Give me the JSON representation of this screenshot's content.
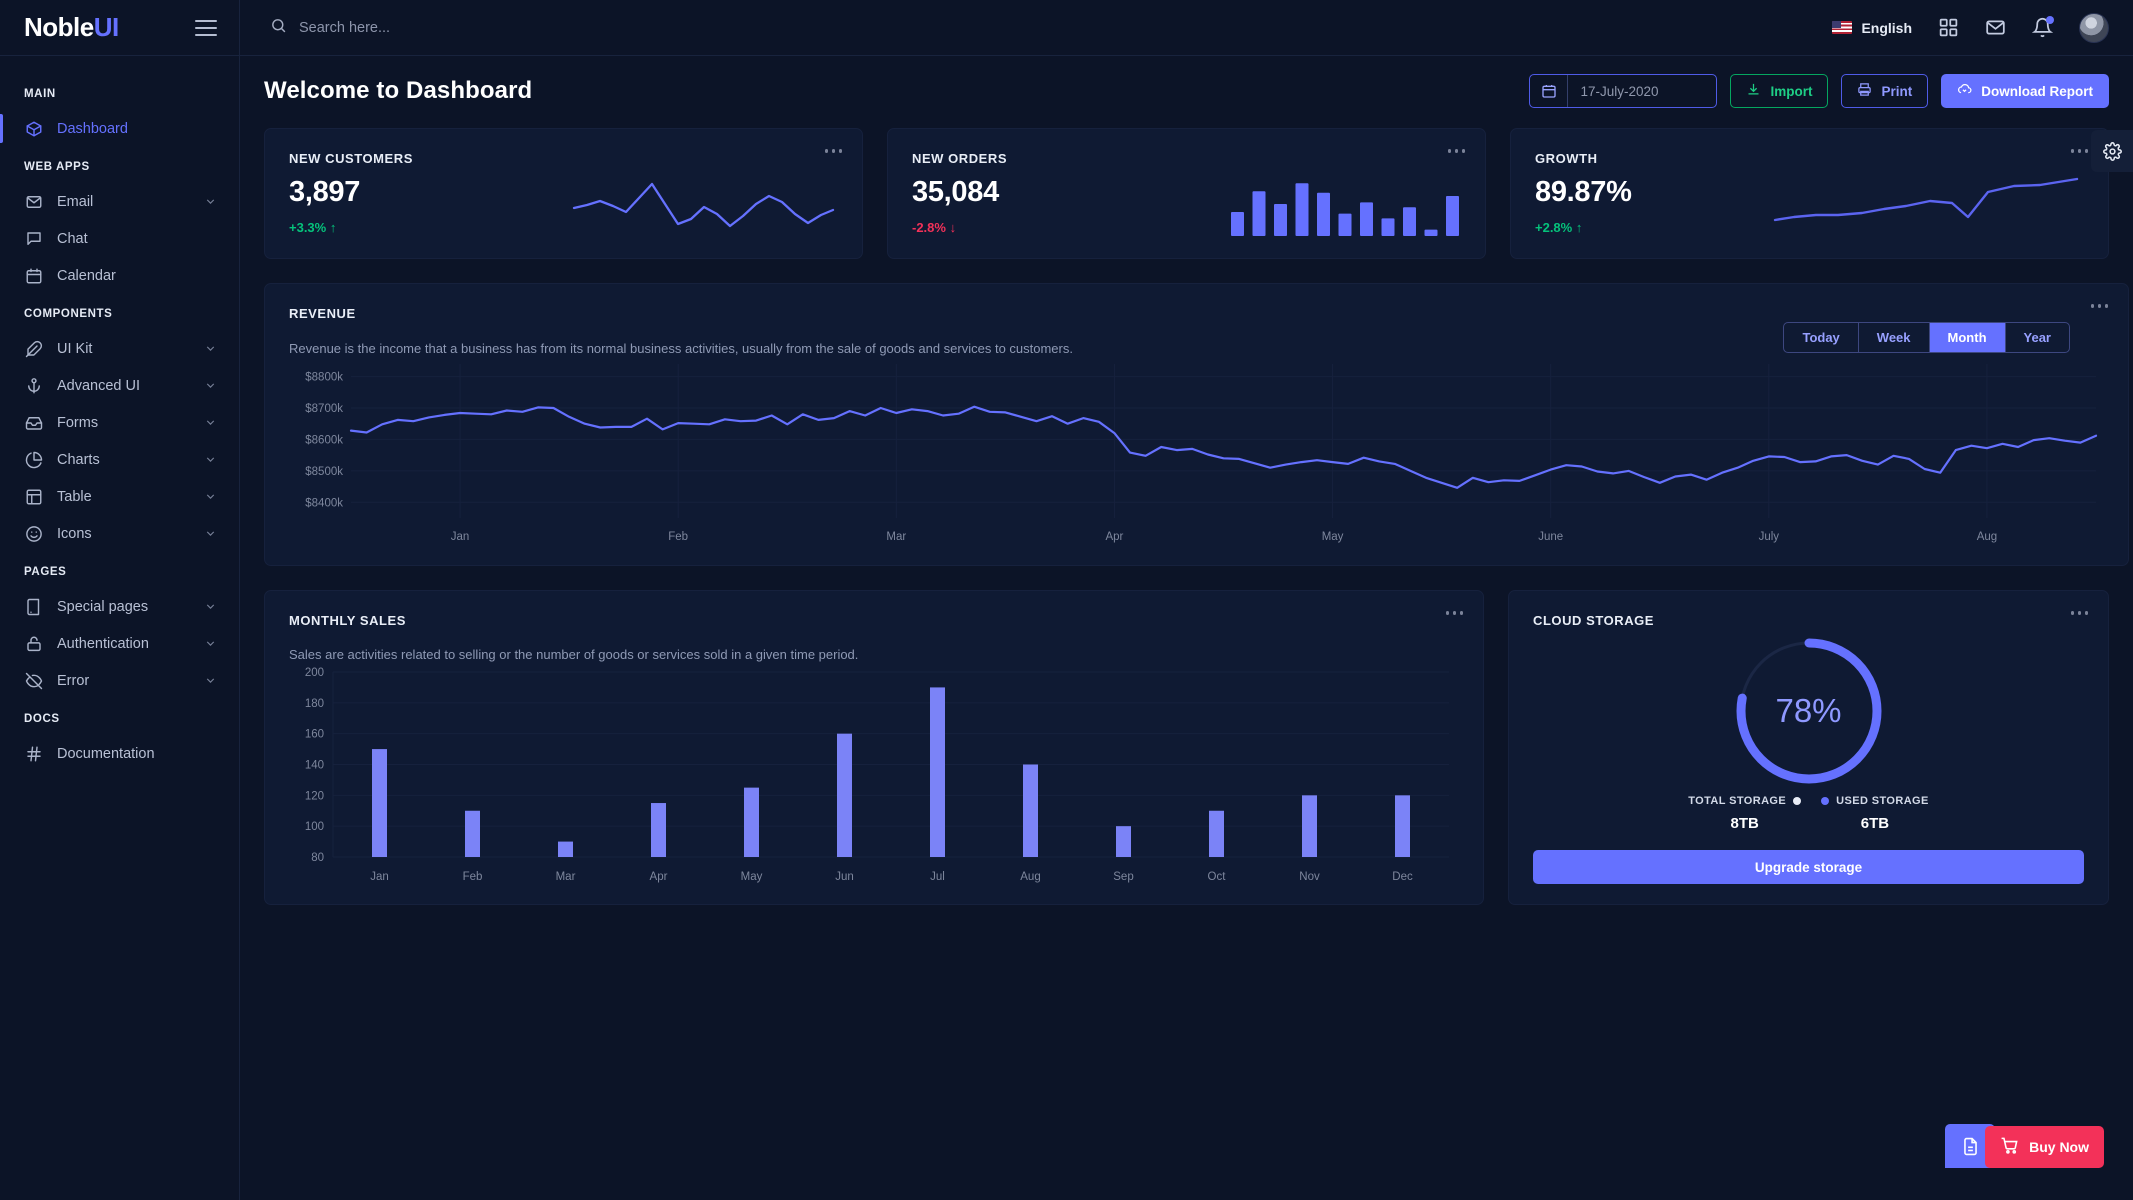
{
  "brand": {
    "part1": "Noble",
    "part2": "UI"
  },
  "topbar": {
    "search_placeholder": "Search here...",
    "language": "English",
    "icons": {
      "apps": "grid-apps-icon",
      "mail": "mail-icon",
      "bell": "bell-icon"
    }
  },
  "sidebar": {
    "sections": [
      {
        "label": "MAIN",
        "items": [
          {
            "label": "Dashboard",
            "icon": "box-icon",
            "active": true,
            "caret": false
          }
        ]
      },
      {
        "label": "WEB APPS",
        "items": [
          {
            "label": "Email",
            "icon": "mail-icon",
            "active": false,
            "caret": true
          },
          {
            "label": "Chat",
            "icon": "chat-icon",
            "active": false,
            "caret": false
          },
          {
            "label": "Calendar",
            "icon": "calendar-icon",
            "active": false,
            "caret": false
          }
        ]
      },
      {
        "label": "COMPONENTS",
        "items": [
          {
            "label": "UI Kit",
            "icon": "feather-icon",
            "active": false,
            "caret": true
          },
          {
            "label": "Advanced UI",
            "icon": "anchor-icon",
            "active": false,
            "caret": true
          },
          {
            "label": "Forms",
            "icon": "inbox-icon",
            "active": false,
            "caret": true
          },
          {
            "label": "Charts",
            "icon": "pie-chart-icon",
            "active": false,
            "caret": true
          },
          {
            "label": "Table",
            "icon": "table-layout-icon",
            "active": false,
            "caret": true
          },
          {
            "label": "Icons",
            "icon": "smile-icon",
            "active": false,
            "caret": true
          }
        ]
      },
      {
        "label": "PAGES",
        "items": [
          {
            "label": "Special pages",
            "icon": "book-icon",
            "active": false,
            "caret": true
          },
          {
            "label": "Authentication",
            "icon": "lock-icon",
            "active": false,
            "caret": true
          },
          {
            "label": "Error",
            "icon": "slash-eye-icon",
            "active": false,
            "caret": true
          }
        ]
      },
      {
        "label": "DOCS",
        "items": [
          {
            "label": "Documentation",
            "icon": "hash-icon",
            "active": false,
            "caret": false
          }
        ]
      }
    ]
  },
  "header": {
    "title": "Welcome to Dashboard",
    "date_value": "17-July-2020",
    "import_label": "Import",
    "print_label": "Print",
    "download_label": "Download Report"
  },
  "stats": [
    {
      "title": "NEW CUSTOMERS",
      "value": "3,897",
      "delta": "+3.3% ↑",
      "dir": "up"
    },
    {
      "title": "NEW ORDERS",
      "value": "35,084",
      "delta": "-2.8% ↓",
      "dir": "down"
    },
    {
      "title": "GROWTH",
      "value": "89.87%",
      "delta": "+2.8% ↑",
      "dir": "up"
    }
  ],
  "revenue": {
    "title": "REVENUE",
    "description": "Revenue is the income that a business has from its normal business activities, usually from the sale of goods and services to customers.",
    "ranges": [
      "Today",
      "Week",
      "Month",
      "Year"
    ],
    "active_range": "Month"
  },
  "monthly_sales": {
    "title": "MONTHLY SALES",
    "description": "Sales are activities related to selling or the number of goods or services sold in a given time period."
  },
  "cloud_storage": {
    "title": "CLOUD STORAGE",
    "percent": "78%",
    "total_label": "TOTAL STORAGE",
    "total_value": "8TB",
    "used_label": "USED STORAGE",
    "used_value": "6TB",
    "upgrade_label": "Upgrade storage"
  },
  "floating": {
    "buy_label": "Buy Now",
    "doc_icon": "document-icon",
    "gear_icon": "gear-icon"
  },
  "colors": {
    "accent": "#6571ff",
    "success": "#05c27b",
    "danger": "#f33159",
    "card_bg": "#0f1a33",
    "page_bg": "#0c1427",
    "grid": "#16213d"
  },
  "chart_data": [
    {
      "type": "line",
      "name": "new-customers-sparkline",
      "title": "NEW CUSTOMERS",
      "x": [
        0,
        1,
        2,
        3,
        4,
        5,
        6,
        7,
        8,
        9,
        10,
        11,
        12,
        13,
        14,
        15,
        16,
        17,
        18,
        19,
        20
      ],
      "values": [
        38,
        46,
        52,
        44,
        36,
        58,
        76,
        52,
        28,
        34,
        46,
        40,
        26,
        38,
        52,
        62,
        56,
        40,
        30,
        38,
        44
      ],
      "grid": false,
      "legend": "none"
    },
    {
      "type": "bar",
      "name": "new-orders-sparkbars",
      "title": "NEW ORDERS",
      "categories": [
        "1",
        "2",
        "3",
        "4",
        "5",
        "6",
        "7",
        "8",
        "9",
        "10",
        "11"
      ],
      "values": [
        30,
        56,
        40,
        66,
        54,
        28,
        42,
        22,
        36,
        8,
        50
      ],
      "grid": false,
      "legend": "none"
    },
    {
      "type": "line",
      "name": "growth-sparkline",
      "title": "GROWTH",
      "x": [
        0,
        1,
        2,
        3,
        4,
        5,
        6,
        7,
        8,
        9,
        10,
        11,
        12,
        13
      ],
      "values": [
        20,
        24,
        26,
        26,
        28,
        32,
        36,
        42,
        40,
        24,
        52,
        60,
        62,
        72
      ],
      "grid": false,
      "legend": "none"
    },
    {
      "type": "line",
      "name": "revenue-chart",
      "title": "REVENUE",
      "ylabel": "",
      "xlabel": "",
      "ytick_labels": [
        "$8800k",
        "$8700k",
        "$8600k",
        "$8500k",
        "$8400k"
      ],
      "ytick_values": [
        8800,
        8700,
        8600,
        8500,
        8400
      ],
      "ylim": [
        8350,
        8840
      ],
      "xtick_labels": [
        "Jan",
        "Feb",
        "Mar",
        "Apr",
        "May",
        "June",
        "July",
        "Aug"
      ],
      "grid": true,
      "legend": "none",
      "values": [
        8628,
        8622,
        8648,
        8662,
        8658,
        8670,
        8678,
        8684,
        8682,
        8680,
        8692,
        8688,
        8702,
        8700,
        8672,
        8650,
        8638,
        8640,
        8640,
        8666,
        8632,
        8652,
        8650,
        8648,
        8664,
        8658,
        8660,
        8676,
        8648,
        8680,
        8662,
        8668,
        8690,
        8676,
        8700,
        8684,
        8696,
        8690,
        8676,
        8682,
        8704,
        8688,
        8686,
        8672,
        8658,
        8674,
        8650,
        8668,
        8656,
        8620,
        8558,
        8548,
        8576,
        8566,
        8570,
        8552,
        8540,
        8538,
        8524,
        8510,
        8520,
        8528,
        8534,
        8528,
        8522,
        8542,
        8530,
        8522,
        8500,
        8478,
        8462,
        8446,
        8478,
        8464,
        8470,
        8468,
        8486,
        8504,
        8518,
        8514,
        8498,
        8492,
        8500,
        8480,
        8462,
        8482,
        8488,
        8472,
        8494,
        8510,
        8532,
        8546,
        8544,
        8528,
        8530,
        8546,
        8550,
        8532,
        8520,
        8548,
        8538,
        8506,
        8494,
        8566,
        8580,
        8572,
        8586,
        8576,
        8598,
        8604,
        8596,
        8590,
        8612
      ]
    },
    {
      "type": "bar",
      "name": "monthly-sales-chart",
      "title": "MONTHLY SALES",
      "categories": [
        "Jan",
        "Feb",
        "Mar",
        "Apr",
        "May",
        "Jun",
        "Jul",
        "Aug",
        "Sep",
        "Oct",
        "Nov",
        "Dec"
      ],
      "values": [
        150,
        110,
        90,
        115,
        125,
        160,
        190,
        140,
        100,
        110,
        120,
        120
      ],
      "ytick_labels": [
        "80",
        "100",
        "120",
        "140",
        "160",
        "180",
        "200"
      ],
      "ylim": [
        80,
        200
      ],
      "ylabel": "",
      "xlabel": "",
      "grid": true,
      "legend": "none"
    },
    {
      "type": "pie",
      "name": "cloud-storage-gauge",
      "title": "CLOUD STORAGE",
      "labels": [
        "Used storage",
        "Free"
      ],
      "values": [
        78,
        22
      ],
      "unit": "%",
      "center_label": "78%",
      "legend": "bottom"
    }
  ]
}
